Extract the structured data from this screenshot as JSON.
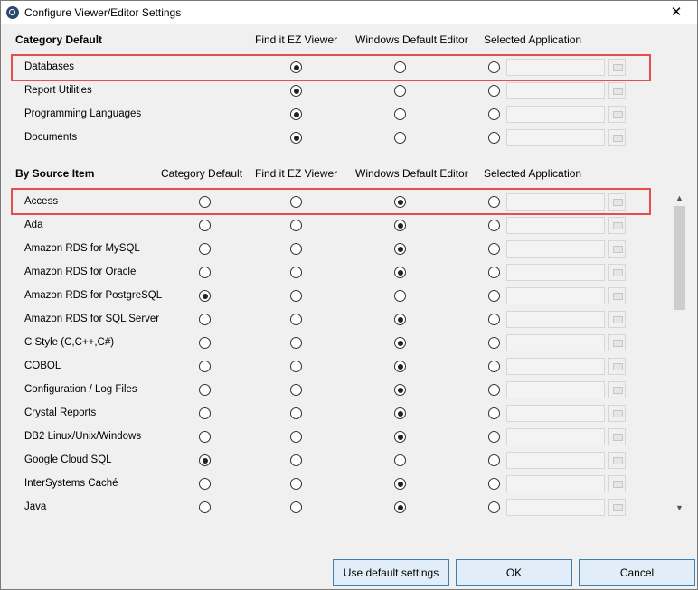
{
  "window": {
    "title": "Configure Viewer/Editor Settings",
    "close_glyph": "✕"
  },
  "category_default": {
    "title": "Category Default",
    "headers": [
      "Find it EZ Viewer",
      "Windows Default Editor",
      "Selected Application"
    ],
    "rows": [
      {
        "label": "Databases",
        "selected": 0,
        "app": ""
      },
      {
        "label": "Report Utilities",
        "selected": 0,
        "app": ""
      },
      {
        "label": "Programming Languages",
        "selected": 0,
        "app": ""
      },
      {
        "label": "Documents",
        "selected": 0,
        "app": ""
      }
    ]
  },
  "by_source": {
    "title": "By Source Item",
    "headers": [
      "Category Default",
      "Find it EZ Viewer",
      "Windows Default Editor",
      "Selected Application"
    ],
    "rows": [
      {
        "label": "Access",
        "selected": 2,
        "app": ""
      },
      {
        "label": "Ada",
        "selected": 2,
        "app": ""
      },
      {
        "label": "Amazon RDS for MySQL",
        "selected": 2,
        "app": ""
      },
      {
        "label": "Amazon RDS for Oracle",
        "selected": 2,
        "app": ""
      },
      {
        "label": "Amazon RDS for PostgreSQL",
        "selected": 0,
        "app": ""
      },
      {
        "label": "Amazon RDS for SQL Server",
        "selected": 2,
        "app": ""
      },
      {
        "label": "C Style (C,C++,C#)",
        "selected": 2,
        "app": ""
      },
      {
        "label": "COBOL",
        "selected": 2,
        "app": ""
      },
      {
        "label": "Configuration / Log Files",
        "selected": 2,
        "app": ""
      },
      {
        "label": "Crystal Reports",
        "selected": 2,
        "app": ""
      },
      {
        "label": "DB2 Linux/Unix/Windows",
        "selected": 2,
        "app": ""
      },
      {
        "label": "Google Cloud SQL",
        "selected": 0,
        "app": ""
      },
      {
        "label": "InterSystems Caché",
        "selected": 2,
        "app": ""
      },
      {
        "label": "Java",
        "selected": 2,
        "app": ""
      }
    ]
  },
  "buttons": {
    "defaults": "Use default settings",
    "ok": "OK",
    "cancel": "Cancel"
  },
  "colors": {
    "highlight": "#e05050",
    "button_border": "#3c7fb1",
    "button_bg": "#e1eef9"
  }
}
